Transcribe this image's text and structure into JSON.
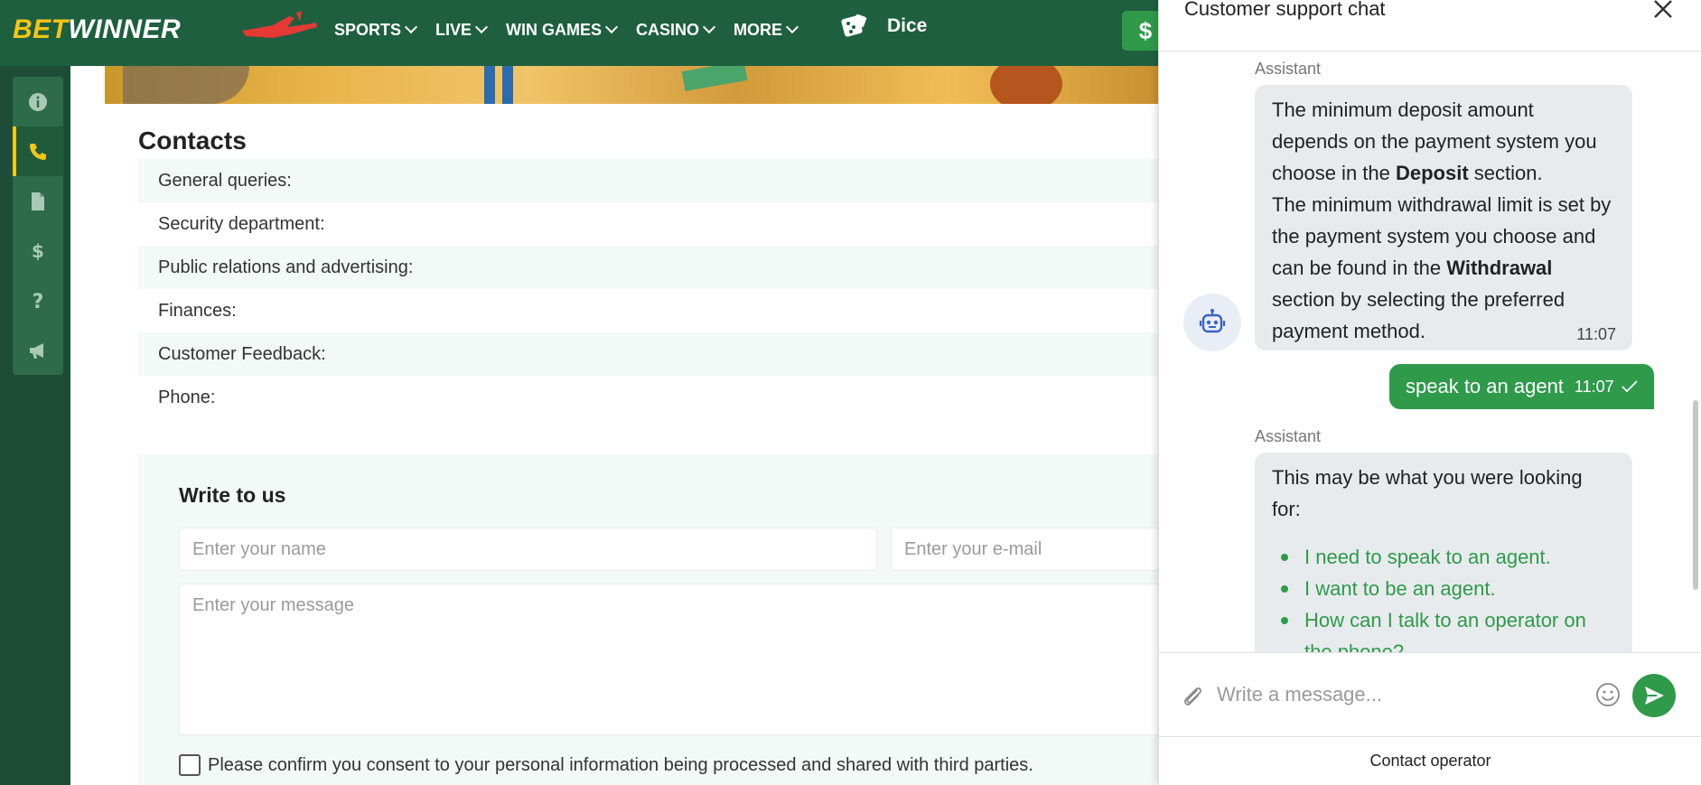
{
  "header": {
    "logo_bet": "BET",
    "logo_winner": "WINNER",
    "nav": [
      {
        "label": "SPORTS"
      },
      {
        "label": "LIVE"
      },
      {
        "label": "WIN GAMES"
      },
      {
        "label": "CASINO"
      },
      {
        "label": "MORE"
      }
    ],
    "dice_label": "Dice",
    "dollar_label": "$"
  },
  "sidebar": {
    "items": [
      {
        "icon": "info-icon"
      },
      {
        "icon": "phone-icon",
        "active": true
      },
      {
        "icon": "document-icon"
      },
      {
        "icon": "dollar-icon"
      },
      {
        "icon": "question-icon"
      },
      {
        "icon": "megaphone-icon"
      }
    ]
  },
  "contacts": {
    "title": "Contacts",
    "rows": [
      {
        "label": "General queries:"
      },
      {
        "label": "Security department:"
      },
      {
        "label": "Public relations and advertising:"
      },
      {
        "label": "Finances:"
      },
      {
        "label": "Customer Feedback:"
      },
      {
        "label": "Phone:"
      }
    ]
  },
  "write_to_us": {
    "title": "Write to us",
    "name_placeholder": "Enter your name",
    "email_placeholder": "Enter your e-mail",
    "message_placeholder": "Enter your message",
    "consent_text": "Please confirm you consent to your personal information being processed and shared with third parties."
  },
  "chat": {
    "title": "Customer support chat",
    "msg1": {
      "sender": "Assistant",
      "p1": "The minimum deposit amount depends on the payment system you choose in the ",
      "p1_bold": "Deposit",
      "p1_end": " section.",
      "p2": "The minimum withdrawal limit is set by the payment system you choose and can be found in the ",
      "p2_bold": "Withdrawal",
      "p2_end": " section by selecting the preferred payment method.",
      "time": "11:07"
    },
    "msg2": {
      "text": "speak to an agent",
      "time": "11:07"
    },
    "msg3": {
      "sender": "Assistant",
      "text": "This may be what you were looking for:",
      "suggestions": [
        "I need to speak to an agent.",
        "I want to be an agent.",
        "How can I talk to an operator on the phone?"
      ]
    },
    "composer_placeholder": "Write a message...",
    "contact_operator": "Contact operator"
  },
  "colors": {
    "brand_green": "#1e5f3f",
    "accent_green": "#2e9a4a",
    "logo_yellow": "#f5c518"
  }
}
